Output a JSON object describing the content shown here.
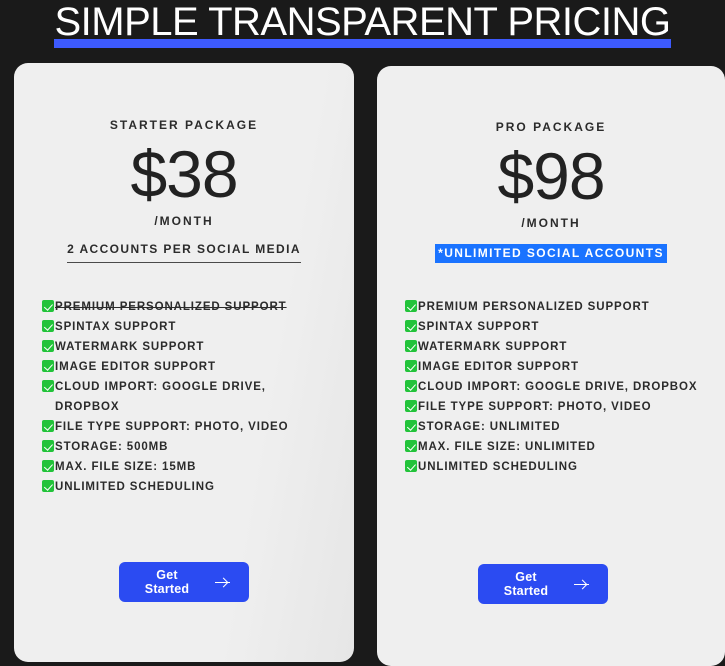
{
  "page": {
    "title": "SIMPLE TRANSPARENT PRICING",
    "background_color": "#1a1a1a",
    "accent_color": "#2b4bf2",
    "title_underline_color": "#3d5afe",
    "highlight_color": "#1a73ff",
    "check_color": "#22c33a",
    "card_color": "#efefef"
  },
  "plans": [
    {
      "id": "starter",
      "name": "STARTER PACKAGE",
      "price": "$38",
      "period": "/MONTH",
      "accounts_note": "2 ACCOUNTS PER SOCIAL MEDIA",
      "accounts_note_style": "underline",
      "features": [
        {
          "icon": "check-icon",
          "label": "PREMIUM PERSONALIZED SUPPORT",
          "enabled": false
        },
        {
          "icon": "check-icon",
          "label": "SPINTAX SUPPORT",
          "enabled": true
        },
        {
          "icon": "check-icon",
          "label": "WATERMARK SUPPORT",
          "enabled": true
        },
        {
          "icon": "check-icon",
          "label": "IMAGE EDITOR SUPPORT",
          "enabled": true
        },
        {
          "icon": "check-icon",
          "label": "CLOUD IMPORT: GOOGLE DRIVE, DROPBOX",
          "enabled": true
        },
        {
          "icon": "check-icon",
          "label": "FILE TYPE SUPPORT: PHOTO, VIDEO",
          "enabled": true
        },
        {
          "icon": "check-icon",
          "label": "STORAGE: 500MB",
          "enabled": true
        },
        {
          "icon": "check-icon",
          "label": "MAX. FILE SIZE: 15MB",
          "enabled": true
        },
        {
          "icon": "check-icon",
          "label": "UNLIMITED SCHEDULING",
          "enabled": true
        }
      ],
      "cta_label": "Get Started"
    },
    {
      "id": "pro",
      "name": "PRO PACKAGE",
      "price": "$98",
      "period": "/MONTH",
      "accounts_note": "*UNLIMITED SOCIAL ACCOUNTS",
      "accounts_note_style": "highlight",
      "features": [
        {
          "icon": "check-icon",
          "label": "PREMIUM PERSONALIZED SUPPORT",
          "enabled": true
        },
        {
          "icon": "check-icon",
          "label": "SPINTAX SUPPORT",
          "enabled": true
        },
        {
          "icon": "check-icon",
          "label": "WATERMARK SUPPORT",
          "enabled": true
        },
        {
          "icon": "check-icon",
          "label": "IMAGE EDITOR SUPPORT",
          "enabled": true
        },
        {
          "icon": "check-icon",
          "label": "CLOUD IMPORT: GOOGLE DRIVE, DROPBOX",
          "enabled": true
        },
        {
          "icon": "check-icon",
          "label": "FILE TYPE SUPPORT: PHOTO, VIDEO",
          "enabled": true
        },
        {
          "icon": "check-icon",
          "label": "STORAGE: UNLIMITED",
          "enabled": true
        },
        {
          "icon": "check-icon",
          "label": "MAX. FILE SIZE: UNLIMITED",
          "enabled": true
        },
        {
          "icon": "check-icon",
          "label": "UNLIMITED SCHEDULING",
          "enabled": true
        }
      ],
      "cta_label": "Get Started"
    }
  ]
}
